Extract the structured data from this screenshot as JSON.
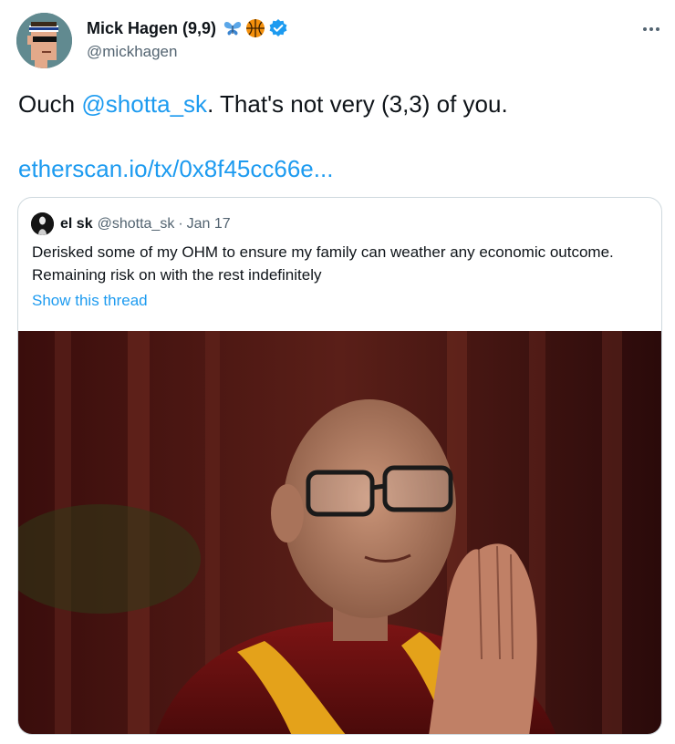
{
  "author": {
    "display_name": "Mick Hagen (9,9)",
    "badges": [
      "butterfly-emoji",
      "basketball-emoji",
      "verified-badge-icon"
    ],
    "handle": "@mickhagen"
  },
  "tweet": {
    "text_prefix": "Ouch ",
    "mention": "@shotta_sk",
    "text_suffix": ". That's not very (3,3) of you.",
    "link": "etherscan.io/tx/0x8f45cc66e..."
  },
  "quoted": {
    "display_name": "el sk",
    "handle": "@shotta_sk",
    "separator": "·",
    "date": "Jan 17",
    "text": "Derisked some of my OHM to ensure my family can weather any economic outcome. Remaining risk on with the rest indefinitely",
    "show_thread": "Show this thread",
    "image_desc_icon": "photo-monk-praying"
  },
  "colors": {
    "accent": "#1d9bf0",
    "text": "#0f1419",
    "muted": "#536471",
    "border": "#cfd9de"
  }
}
